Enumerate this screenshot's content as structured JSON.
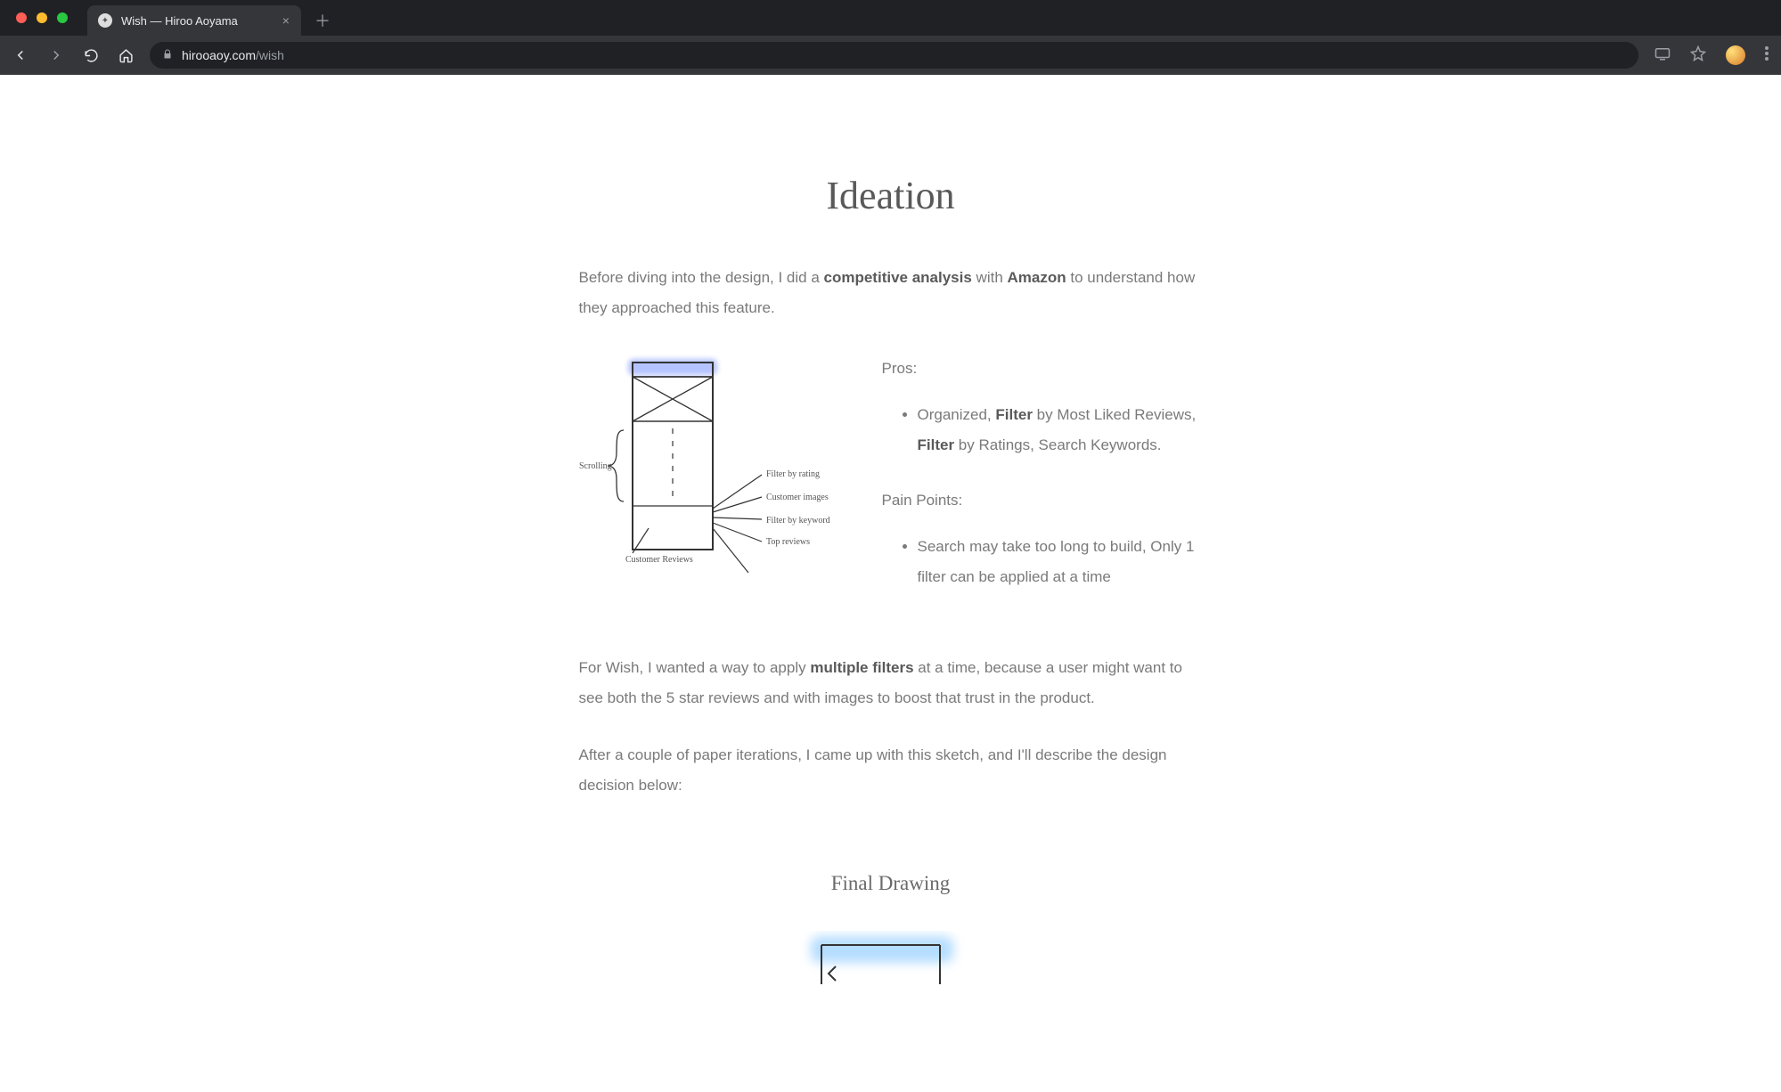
{
  "browser": {
    "tab_title": "Wish — Hiroo Aoyama",
    "url_host": "hirooaoy.com",
    "url_path": "/wish"
  },
  "page": {
    "section_title": "Ideation",
    "intro_parts": {
      "p1a": "Before diving into the design, I did a ",
      "p1b": "competitive analysis",
      "p1c": " with ",
      "p1d": "Amazon",
      "p1e": " to understand how they approached this feature."
    },
    "sketch_labels": {
      "scrolling": "Scrolling",
      "customer_reviews": "Customer Reviews",
      "filter_rating": "Filter by rating",
      "customer_images": "Customer images",
      "filter_keyword": "Filter by keyword",
      "top_reviews": "Top reviews"
    },
    "pros_label": "Pros:",
    "pros_items": {
      "a1": "Organized, ",
      "a2": "Filter",
      "a3": " by Most Liked Reviews, ",
      "a4": "Filter",
      "a5": " by Ratings, Search Keywords."
    },
    "pain_label": "Pain Points:",
    "pain_items": {
      "b1": "Search may take too long to build, Only 1 filter can be applied at a time"
    },
    "para2_parts": {
      "a": "For Wish, I wanted a way to apply ",
      "b": "multiple filters",
      "c": " at a time, because a user might want to see both the 5 star reviews and with images to boost that trust in the product."
    },
    "para3": "After a couple of paper iterations, I came up with this sketch, and I'll describe the design decision below:",
    "subheading": "Final Drawing"
  }
}
